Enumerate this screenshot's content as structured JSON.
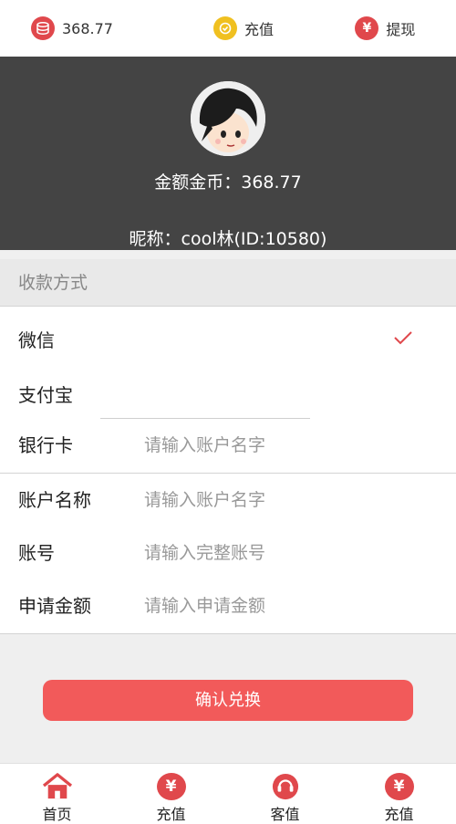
{
  "topbar": {
    "balance": "368.77",
    "recharge": "充值",
    "withdraw": "提现"
  },
  "profile": {
    "coins_label": "金额金币：368.77",
    "nickname": "昵称：cool林(ID:10580)"
  },
  "section_title": "收款方式",
  "payment_methods": [
    {
      "label": "微信",
      "selected": true
    },
    {
      "label": "支付宝",
      "selected": false
    },
    {
      "label": "银行卡",
      "selected": false
    }
  ],
  "form": {
    "bank_placeholder": "请输入账户名字",
    "account_name": {
      "label": "账户名称",
      "placeholder": "请输入账户名字"
    },
    "account_no": {
      "label": "账号",
      "placeholder": "请输入完整账号"
    },
    "amount": {
      "label": "申请金额",
      "placeholder": "请输入申请金额"
    }
  },
  "confirm_button": "确认兑换",
  "tabbar": [
    {
      "label": "首页",
      "icon": "home-icon"
    },
    {
      "label": "充值",
      "icon": "yen-icon"
    },
    {
      "label": "客值",
      "icon": "service-icon"
    },
    {
      "label": "充值",
      "icon": "yen-icon"
    }
  ],
  "colors": {
    "accent": "#e0484c",
    "button": "#f25a5a",
    "header_bg": "#444444"
  }
}
